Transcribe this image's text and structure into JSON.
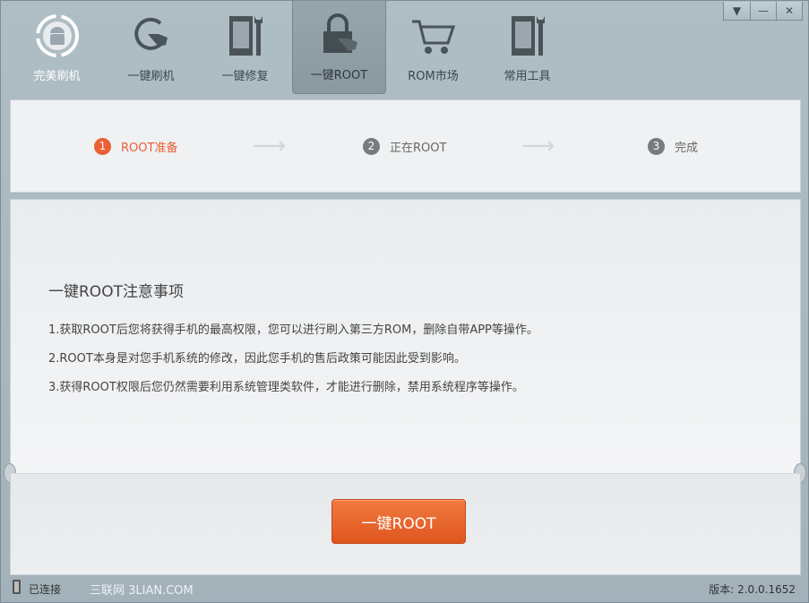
{
  "nav": [
    {
      "label": "完美刷机",
      "icon": "android-refresh-icon"
    },
    {
      "label": "一键刷机",
      "icon": "refresh-hand-icon"
    },
    {
      "label": "一键修复",
      "icon": "phone-wrench-icon"
    },
    {
      "label": "一键ROOT",
      "icon": "lock-hand-icon"
    },
    {
      "label": "ROM市场",
      "icon": "cart-icon"
    },
    {
      "label": "常用工具",
      "icon": "tools-icon"
    }
  ],
  "window_controls": {
    "menu": "▼",
    "minimize": "—",
    "close": "✕"
  },
  "steps": [
    {
      "num": "1",
      "label": "ROOT准备"
    },
    {
      "num": "2",
      "label": "正在ROOT"
    },
    {
      "num": "3",
      "label": "完成"
    }
  ],
  "main": {
    "title": "一键ROOT注意事项",
    "notes": [
      "1.获取ROOT后您将获得手机的最高权限，您可以进行刷入第三方ROM，删除自带APP等操作。",
      "2.ROOT本身是对您手机系统的修改，因此您手机的售后政策可能因此受到影响。",
      "3.获得ROOT权限后您仍然需要利用系统管理类软件，才能进行删除，禁用系统程序等操作。"
    ]
  },
  "root_button": "一键ROOT",
  "status": {
    "connection": "已连接",
    "watermark": "三联网 3LIAN.COM",
    "version": "版本: 2.0.0.1652"
  },
  "colors": {
    "accent": "#ea5f35"
  }
}
